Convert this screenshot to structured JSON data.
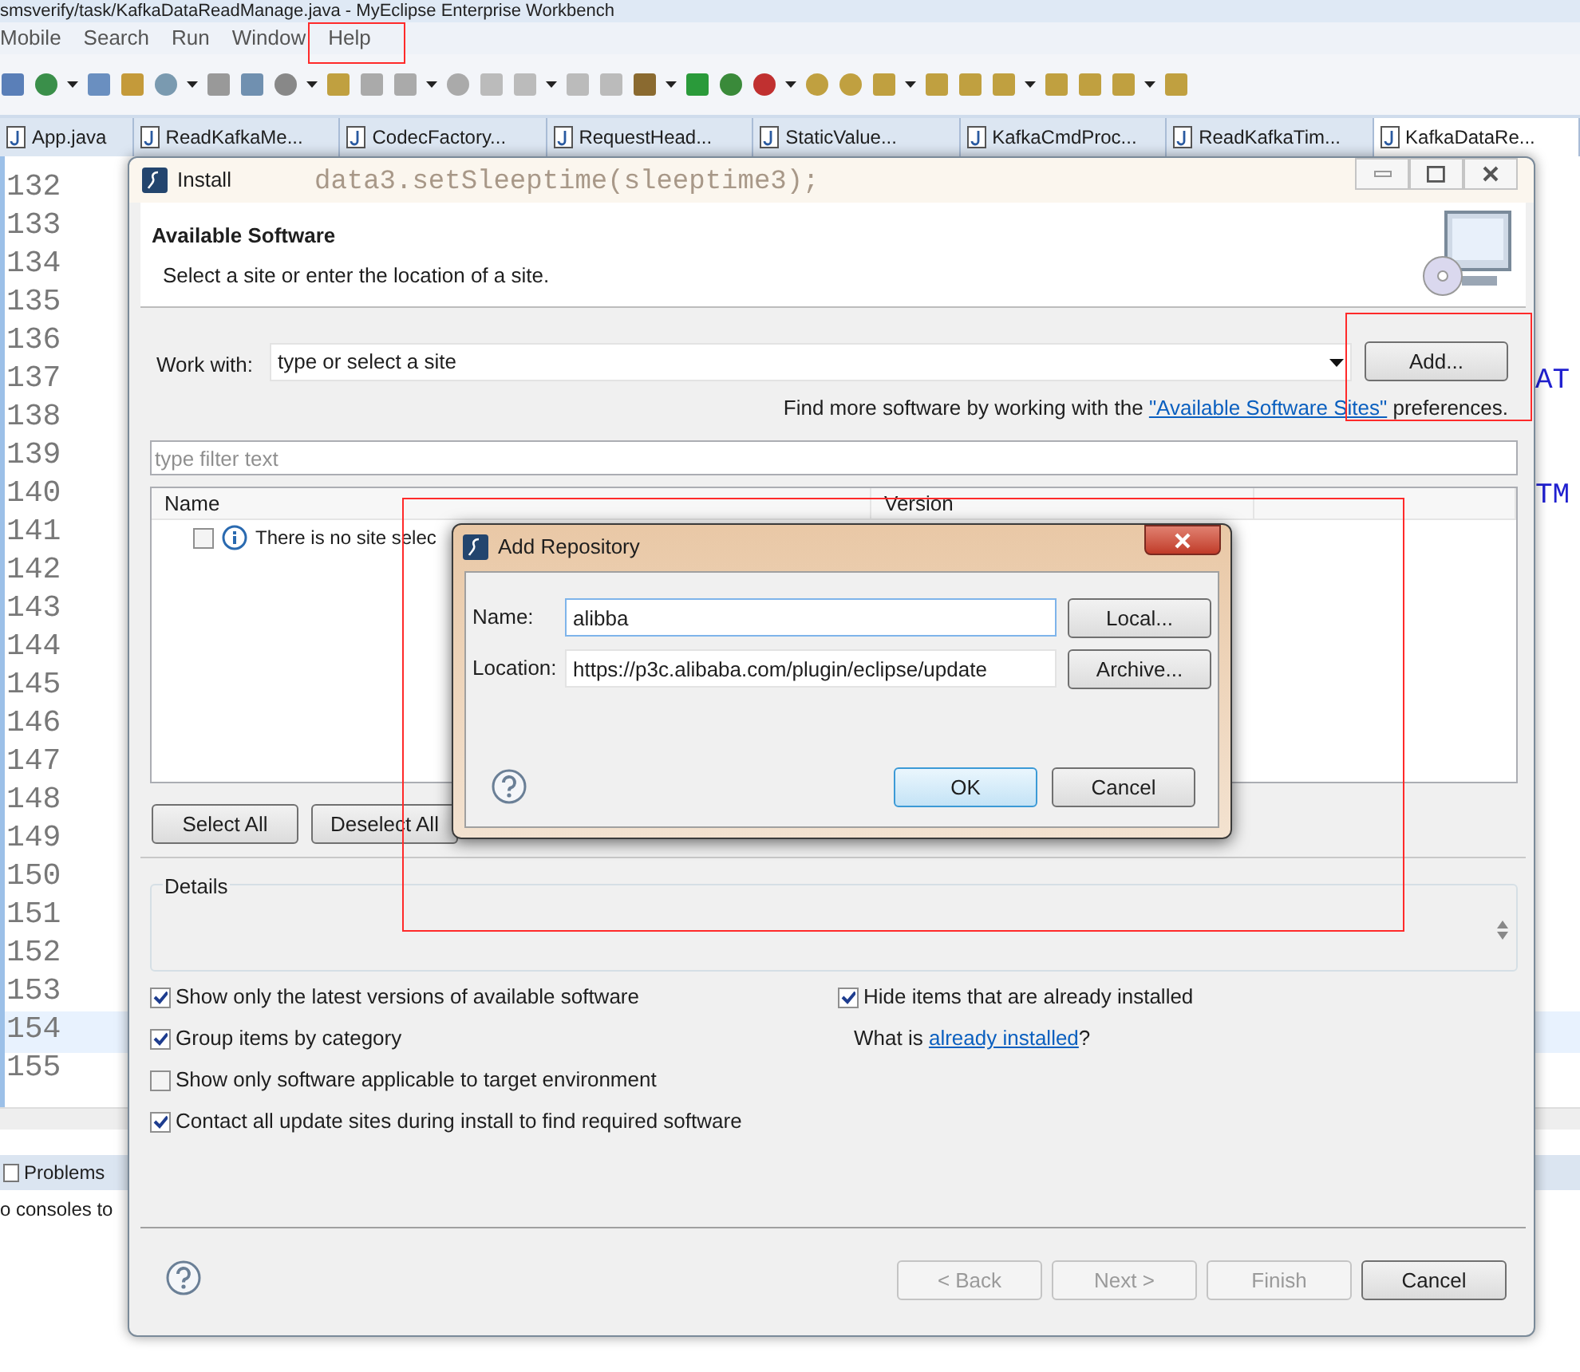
{
  "ide": {
    "title": "smsverify/task/KafkaDataReadManage.java - MyEclipse Enterprise Workbench",
    "menu": [
      "Mobile",
      "Search",
      "Run",
      "Window",
      "Help"
    ],
    "editor_tabs": [
      {
        "label": "App.java",
        "selected": false
      },
      {
        "label": "ReadKafkaMe...",
        "selected": false
      },
      {
        "label": "CodecFactory...",
        "selected": false
      },
      {
        "label": "RequestHead...",
        "selected": false
      },
      {
        "label": "StaticValue...",
        "selected": false
      },
      {
        "label": "KafkaCmdProc...",
        "selected": false
      },
      {
        "label": "ReadKafkaTim...",
        "selected": false
      },
      {
        "label": "KafkaDataRe...",
        "selected": true
      }
    ],
    "line_numbers": [
      "132",
      "133",
      "134",
      "135",
      "136",
      "137",
      "138",
      "139",
      "140",
      "141",
      "142",
      "143",
      "144",
      "145",
      "146",
      "147",
      "148",
      "149",
      "150",
      "151",
      "152",
      "153",
      "154",
      "155"
    ],
    "code_fragments": [
      "data3.setSleeptime(sleeptime3);",
      "AT",
      "TM"
    ],
    "bottom_panel": {
      "tab": "Problems",
      "message": "o consoles to"
    }
  },
  "install_dialog": {
    "title": "Install",
    "heading": "Available Software",
    "description": "Select a site or enter the location of a site.",
    "work_with": {
      "label": "Work with:",
      "placeholder": "type or select a site"
    },
    "add_button": "Add...",
    "hint": {
      "before": "Find more software by working with the",
      "link": "\"Available Software Sites\"",
      "after": "preferences."
    },
    "filter": {
      "placeholder": "type filter text"
    },
    "table": {
      "columns": [
        "Name",
        "Version"
      ],
      "rows": [
        {
          "checked": false,
          "text": "There is no site selec"
        }
      ]
    },
    "list_buttons": [
      "Select All",
      "Deselect All"
    ],
    "details_label": "Details",
    "left_options": [
      {
        "label": "Show only the latest versions of available software",
        "checked": true
      },
      {
        "label": "Group items by category",
        "checked": true
      },
      {
        "label": "Show only software applicable to target environment",
        "checked": false
      },
      {
        "label": "Contact all update sites during install to find required software",
        "checked": true
      }
    ],
    "right_options": [
      {
        "label": "Hide items that are already installed",
        "checked": true
      }
    ],
    "installed_hint": {
      "before": "What is",
      "link": "already installed",
      "after": "?"
    },
    "buttons": [
      {
        "label": "< Back",
        "disabled": true
      },
      {
        "label": "Next >",
        "disabled": true
      },
      {
        "label": "Finish",
        "disabled": true
      },
      {
        "label": "Cancel",
        "disabled": false
      }
    ]
  },
  "add_repository_dialog": {
    "title": "Add Repository",
    "fields": [
      {
        "label": "Name:",
        "value": "alibba",
        "button": "Local..."
      },
      {
        "label": "Location:",
        "value": "https://p3c.alibaba.com/plugin/eclipse/update",
        "button": "Archive..."
      }
    ],
    "buttons": [
      {
        "label": "OK",
        "selected": true
      },
      {
        "label": "Cancel",
        "selected": false
      }
    ]
  }
}
